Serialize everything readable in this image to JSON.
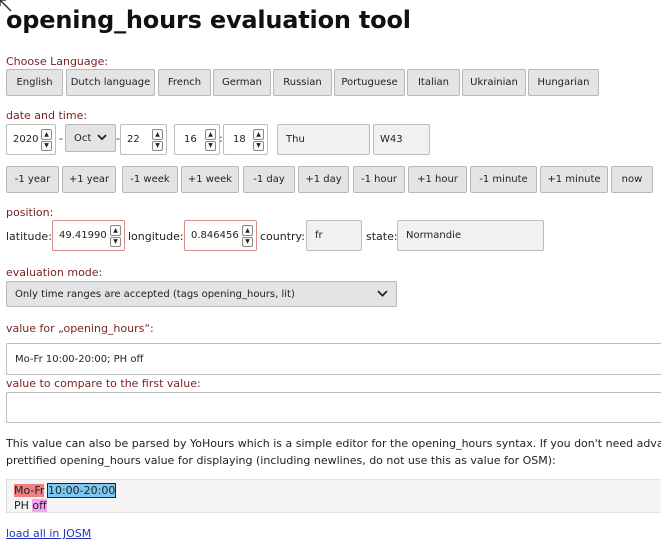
{
  "title": "opening_hours evaluation tool",
  "language": {
    "label": "Choose Language:",
    "buttons": [
      "English",
      "Dutch language",
      "French",
      "German",
      "Russian",
      "Portuguese",
      "Italian",
      "Ukrainian",
      "Hungarian"
    ]
  },
  "datetime": {
    "label": "date and time:",
    "year": "2020",
    "month": "Oct",
    "day": "22",
    "hour": "16",
    "minute": "18",
    "weekday": "Thu",
    "week": "W43",
    "separator_dash": "-",
    "separator_colon": ":"
  },
  "adjust_buttons": [
    "-1 year",
    "+1 year",
    "-1 week",
    "+1 week",
    "-1 day",
    "+1 day",
    "-1 hour",
    "+1 hour",
    "-1 minute",
    "+1 minute",
    "now"
  ],
  "position": {
    "label": "position:",
    "latitude_label": "latitude:",
    "latitude": "49.41990",
    "longitude_label": "longitude:",
    "longitude": "0.846456",
    "country_label": "country:",
    "country": "fr",
    "state_label": "state:",
    "state": "Normandie"
  },
  "mode": {
    "label": "evaluation mode:",
    "selected": "Only time ranges are accepted (tags opening_hours, lit)"
  },
  "value": {
    "label": "value for „opening_hours“:",
    "text": "Mo-Fr 10:00-20:00; PH off"
  },
  "compare": {
    "label": "value to compare to the first value:",
    "text": ""
  },
  "info": {
    "line1": "This value can also be parsed by YoHours which is a simple editor for the opening_hours syntax. If you don't need advanced fe",
    "line2": "prettified opening_hours value for displaying (including newlines, do not use this as value for OSM):"
  },
  "pretty": {
    "days": "Mo-Fr",
    "time": "10:00-20:00",
    "holiday": "PH",
    "off": "off"
  },
  "link": "load all in JOSM",
  "colors": {
    "label": "#7a1f1f",
    "highlight_days": "#f08080",
    "highlight_time": "#7cc8f2",
    "highlight_off": "#f3a3f0"
  }
}
